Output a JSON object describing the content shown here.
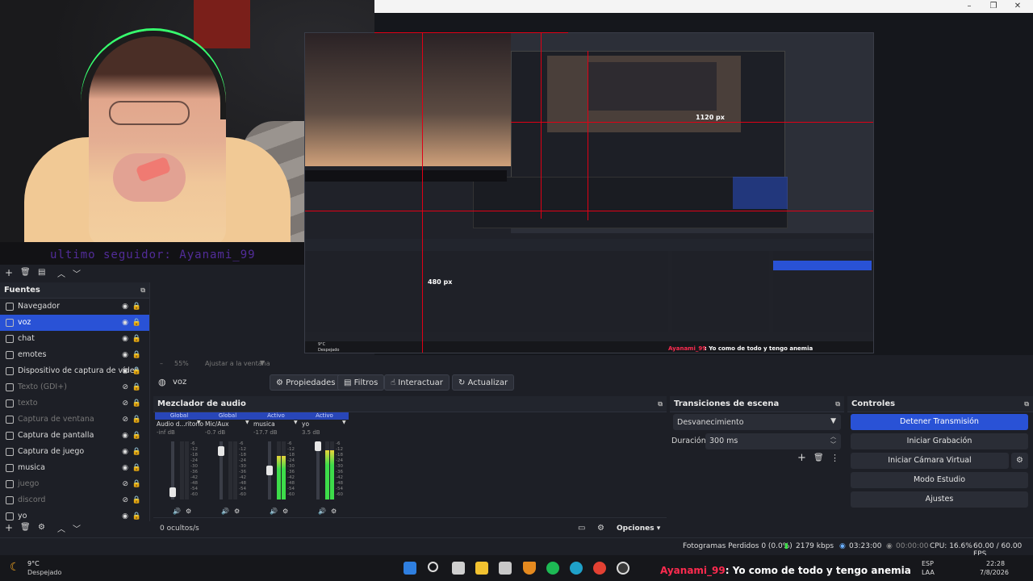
{
  "window": {
    "minimize_glyph": "–",
    "maximize_glyph": "❐",
    "close_glyph": "✕"
  },
  "follower_ticker": "ultimo seguidor: Ayanami_99",
  "preview": {
    "nested_labels": {
      "px1120": "1120 px",
      "px480": "480 px"
    },
    "nested_weather": "9°C",
    "nested_weather_sub": "Despejado",
    "nested_ticker_user": "Ayanami_99",
    "nested_ticker_text": ": Yo como de todo y tengo anemia"
  },
  "zoom": {
    "percent": "55%",
    "fit_label": "Ajustar a la ventana"
  },
  "source_toolbar": {
    "selected_source": "voz",
    "properties": "Propiedades",
    "filters": "Filtros",
    "interact": "Interactuar",
    "refresh": "Actualizar"
  },
  "sources": {
    "title": "Fuentes",
    "items": [
      {
        "label": "Navegador",
        "visible": true,
        "dim": false,
        "selected": false
      },
      {
        "label": "voz",
        "visible": true,
        "dim": false,
        "selected": true
      },
      {
        "label": "chat",
        "visible": true,
        "dim": false,
        "selected": false
      },
      {
        "label": "emotes",
        "visible": true,
        "dim": false,
        "selected": false
      },
      {
        "label": "Dispositivo de captura de vídeo",
        "visible": true,
        "dim": false,
        "selected": false
      },
      {
        "label": "Texto (GDI+)",
        "visible": false,
        "dim": true,
        "selected": false
      },
      {
        "label": "texto",
        "visible": false,
        "dim": true,
        "selected": false
      },
      {
        "label": "Captura de ventana",
        "visible": false,
        "dim": true,
        "selected": false
      },
      {
        "label": "Captura de pantalla",
        "visible": true,
        "dim": false,
        "selected": false
      },
      {
        "label": "Captura de juego",
        "visible": true,
        "dim": false,
        "selected": false
      },
      {
        "label": "musica",
        "visible": true,
        "dim": false,
        "selected": false
      },
      {
        "label": "juego",
        "visible": false,
        "dim": true,
        "selected": false
      },
      {
        "label": "discord",
        "visible": false,
        "dim": true,
        "selected": false
      },
      {
        "label": "yo",
        "visible": true,
        "dim": false,
        "selected": false
      }
    ]
  },
  "mixer": {
    "title": "Mezclador de audio",
    "hidden_count": "0 ocultos/s",
    "options": "Opciones",
    "scale": [
      "-6",
      "-12",
      "-18",
      "-24",
      "-30",
      "-36",
      "-42",
      "-48",
      "-54",
      "-60"
    ],
    "channels": [
      {
        "state": "Global",
        "name": "Audio d...ritorio",
        "db": "-inf dB",
        "level": 0.0,
        "volume": 0.05
      },
      {
        "state": "Global",
        "name": "Mic/Aux",
        "db": "-0.7 dB",
        "level": 0.0,
        "volume": 0.9
      },
      {
        "state": "Activo",
        "name": "musica",
        "db": "-17.7 dB",
        "level": 0.75,
        "volume": 0.5
      },
      {
        "state": "Activo",
        "name": "yo",
        "db": "3.5 dB",
        "level": 0.85,
        "volume": 1.0
      }
    ]
  },
  "transitions": {
    "title": "Transiciones de escena",
    "selected": "Desvanecimiento",
    "duration_label": "Duración",
    "duration_value": "300 ms"
  },
  "controls": {
    "title": "Controles",
    "buttons": [
      "Detener Transmisión",
      "Iniciar Grabación",
      "Iniciar Cámara Virtual",
      "Modo Estudio",
      "Ajustes"
    ]
  },
  "status": {
    "dropped": "Fotogramas Perdidos 0 (0.0%)",
    "bitrate": "2179 kbps",
    "stream_time": "03:23:00",
    "rec_time": "00:00:00",
    "cpu": "CPU: 16.6%",
    "fps": "60.00 / 60.00 FPS"
  },
  "taskbar": {
    "weather_temp": "9°C",
    "weather_desc": "Despejado",
    "ticker_user": "Ayanami_99",
    "ticker_text": ": Yo como de todo y tengo anemia",
    "lang": "ESP",
    "lang_sub": "LAA",
    "time": "22:28",
    "date": "7/8/2026"
  },
  "colors": {
    "accent": "#2952d6",
    "live_red": "#e00015",
    "ticker_user": "#ff2b4f",
    "meter_green": "#3ddc4a",
    "meter_yellow": "#e8d43a"
  }
}
